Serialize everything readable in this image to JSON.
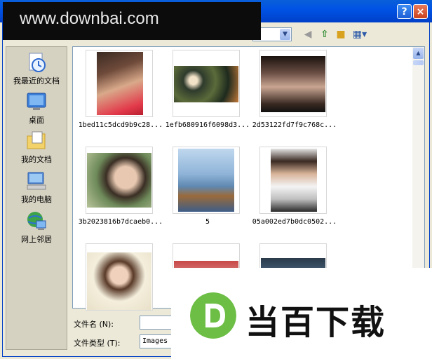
{
  "titlebar": {
    "help_label": "?",
    "close_label": "×"
  },
  "watermark": {
    "text": "www.downbai.com"
  },
  "toolbar": {
    "lookin_dropdown_icon": "chevron-down-icon",
    "icons": [
      "back-icon",
      "up-folder-icon",
      "new-folder-icon",
      "views-menu-icon"
    ]
  },
  "places": [
    {
      "label": "我最近的文档",
      "icon": "recent-documents-icon"
    },
    {
      "label": "桌面",
      "icon": "desktop-icon"
    },
    {
      "label": "我的文档",
      "icon": "my-documents-icon"
    },
    {
      "label": "我的电脑",
      "icon": "my-computer-icon"
    },
    {
      "label": "网上邻居",
      "icon": "network-places-icon"
    }
  ],
  "files": [
    {
      "name": "1bed11c5dcd9b9c28..."
    },
    {
      "name": "1efb680916f6098d3..."
    },
    {
      "name": "2d53122fd7f9c768c..."
    },
    {
      "name": "3b2023816b7dcaeb0..."
    },
    {
      "name": "5"
    },
    {
      "name": "05a002ed7b0dc0502..."
    },
    {
      "name": ""
    },
    {
      "name": ""
    },
    {
      "name": ""
    }
  ],
  "fields": {
    "filename_label": "文件名 (N):",
    "filename_value": "",
    "filetype_label": "文件类型 (T):",
    "filetype_value": "Images"
  },
  "logo": {
    "letter": "D",
    "text": "当百下载",
    "color": "#6DBE45"
  }
}
